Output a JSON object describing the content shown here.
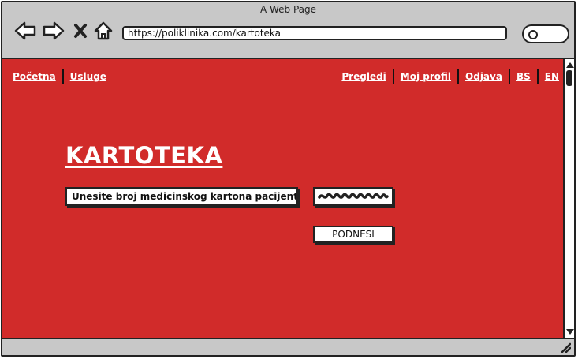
{
  "window": {
    "title": "A Web Page"
  },
  "browser": {
    "url": "https://poliklinika.com/kartoteka",
    "back_icon": "arrow-left-icon",
    "forward_icon": "arrow-right-icon",
    "close_icon": "close-icon",
    "home_icon": "home-icon",
    "search_icon": "search-icon"
  },
  "topnav": {
    "left": [
      {
        "label": "Početna"
      },
      {
        "label": "Usluge"
      }
    ],
    "right": [
      {
        "label": "Pregledi"
      },
      {
        "label": "Moj profil"
      },
      {
        "label": "Odjava"
      },
      {
        "label": "BS"
      },
      {
        "label": "EN"
      }
    ]
  },
  "main": {
    "title": "KARTOTEKA",
    "prompt_label": "Unesite broj medicinskog kartona pacijenta:",
    "submit_label": "PODNESI"
  },
  "colors": {
    "background": "#d12b2a",
    "chrome": "#c8c8c8",
    "text_light": "#ffffff",
    "outline": "#222222"
  }
}
